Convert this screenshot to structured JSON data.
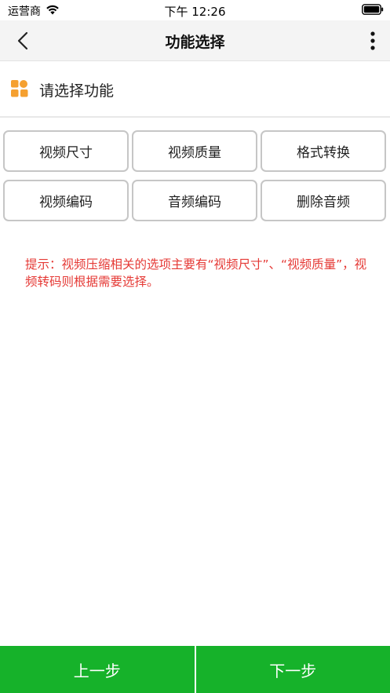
{
  "status_bar": {
    "carrier": "运营商",
    "time": "下午 12:26"
  },
  "nav": {
    "title": "功能选择",
    "back_icon": "chevron-left-icon",
    "more_icon": "more-vertical-icon"
  },
  "section": {
    "icon": "grid-icon",
    "icon_color": "#f5a030",
    "title": "请选择功能"
  },
  "options": [
    {
      "label": "视频尺寸"
    },
    {
      "label": "视频质量"
    },
    {
      "label": "格式转换"
    },
    {
      "label": "视频编码"
    },
    {
      "label": "音频编码"
    },
    {
      "label": "删除音频"
    }
  ],
  "hint": {
    "text": "提示：视频压缩相关的选项主要有“视频尺寸”、“视频质量”，视频转码则根据需要选择。",
    "color": "#e53935"
  },
  "footer": {
    "prev_label": "上一步",
    "next_label": "下一步",
    "color": "#16b22a"
  }
}
